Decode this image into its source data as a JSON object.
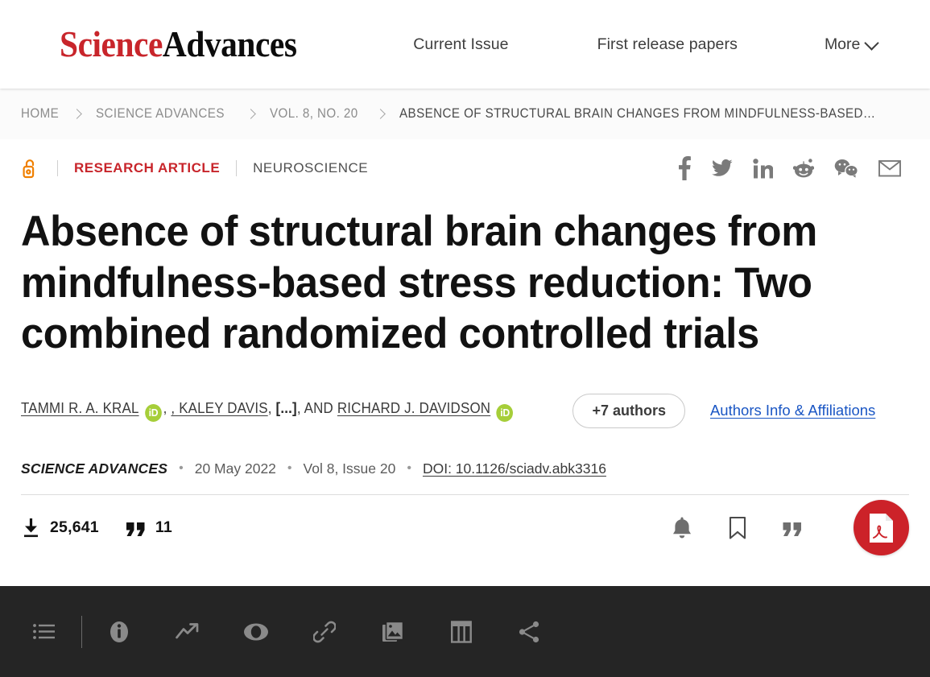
{
  "header": {
    "logo_science": "Science",
    "logo_advances": "Advances",
    "nav": {
      "current_issue": "Current Issue",
      "first_release": "First release papers",
      "more": "More"
    }
  },
  "breadcrumb": {
    "items": [
      {
        "label": "HOME"
      },
      {
        "label": "SCIENCE ADVANCES"
      },
      {
        "label": "VOL. 8, NO. 20"
      },
      {
        "label": "ABSENCE OF STRUCTURAL BRAIN CHANGES FROM MINDFULNESS-BASED…"
      }
    ]
  },
  "article": {
    "access_type": "open-access",
    "type": "RESEARCH ARTICLE",
    "topic": "NEUROSCIENCE",
    "title": "Absence of structural brain changes from mindfulness-based stress reduction: Two combined randomized controlled trials",
    "authors": {
      "first": "TAMMI R. A. KRAL",
      "middle": ", KALEY DAVIS",
      "etal": "[...]",
      "and": ", AND ",
      "last": "RICHARD J. DAVIDSON",
      "orcid_label": "iD",
      "more_authors": "+7 authors",
      "affiliations_link": "Authors Info & Affiliations"
    },
    "journal": {
      "name": "SCIENCE ADVANCES",
      "date": "20 May 2022",
      "volume_issue": "Vol 8, Issue 20",
      "doi": "DOI: 10.1126/sciadv.abk3316",
      "separator": "•"
    },
    "metrics": {
      "downloads": "25,641",
      "citations": "11"
    },
    "share": [
      {
        "name": "facebook-icon"
      },
      {
        "name": "twitter-icon"
      },
      {
        "name": "linkedin-icon"
      },
      {
        "name": "reddit-icon"
      },
      {
        "name": "wechat-icon"
      },
      {
        "name": "email-icon"
      }
    ],
    "actions": [
      {
        "name": "alerts-bell-icon"
      },
      {
        "name": "bookmark-icon"
      },
      {
        "name": "cite-quote-icon"
      },
      {
        "name": "pdf-download-button"
      }
    ]
  },
  "toolbar": {
    "items": [
      {
        "name": "contents-list-icon"
      },
      {
        "name": "info-icon"
      },
      {
        "name": "metrics-trend-icon"
      },
      {
        "name": "view-eye-icon"
      },
      {
        "name": "link-icon"
      },
      {
        "name": "figures-images-icon"
      },
      {
        "name": "tables-icon"
      },
      {
        "name": "share-icon"
      }
    ]
  },
  "colors": {
    "brand_red": "#C8252B",
    "pdf_red": "#CC2229",
    "orcid_green": "#A6CE39",
    "open_access_orange": "#F08000",
    "link_blue": "#1a56c4",
    "toolbar_dark": "#252525"
  }
}
